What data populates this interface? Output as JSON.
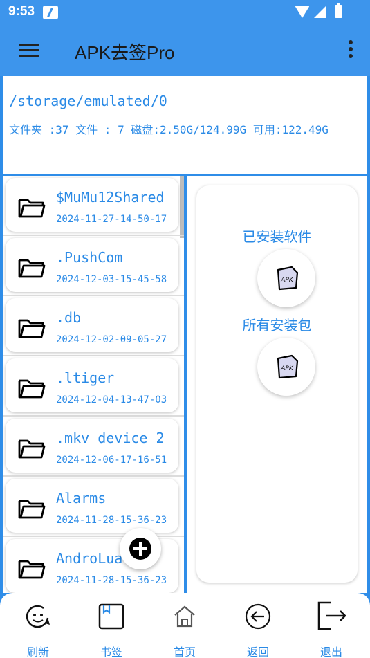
{
  "status": {
    "time": "9:53"
  },
  "appbar": {
    "title": "APK去签Pro"
  },
  "path": {
    "current": "/storage/emulated/0",
    "info": "文件夹 :37    文件 : 7    磁盘:2.50G/124.99G  可用:122.49G"
  },
  "files": [
    {
      "name": "$MuMu12Shared",
      "date": "2024-11-27-14-50-17"
    },
    {
      "name": ".PushCom",
      "date": "2024-12-03-15-45-58"
    },
    {
      "name": ".db",
      "date": "2024-12-02-09-05-27"
    },
    {
      "name": ".ltiger",
      "date": "2024-12-04-13-47-03"
    },
    {
      "name": ".mkv_device_2",
      "date": "2024-12-06-17-16-51"
    },
    {
      "name": "Alarms",
      "date": "2024-11-28-15-36-23"
    },
    {
      "name": "AndroLua",
      "date": "2024-11-28-15-36-23"
    }
  ],
  "panel": {
    "installed_label": "已安装软件",
    "packages_label": "所有安装包",
    "apk_icon_text": "APK"
  },
  "nav": [
    {
      "label": "刷新",
      "icon": "refresh-icon"
    },
    {
      "label": "书签",
      "icon": "bookmark-icon"
    },
    {
      "label": "首页",
      "icon": "home-icon"
    },
    {
      "label": "返回",
      "icon": "back-icon"
    },
    {
      "label": "退出",
      "icon": "exit-icon"
    }
  ],
  "colors": {
    "accent": "#2a8ae6",
    "bar": "#3d95ec"
  }
}
